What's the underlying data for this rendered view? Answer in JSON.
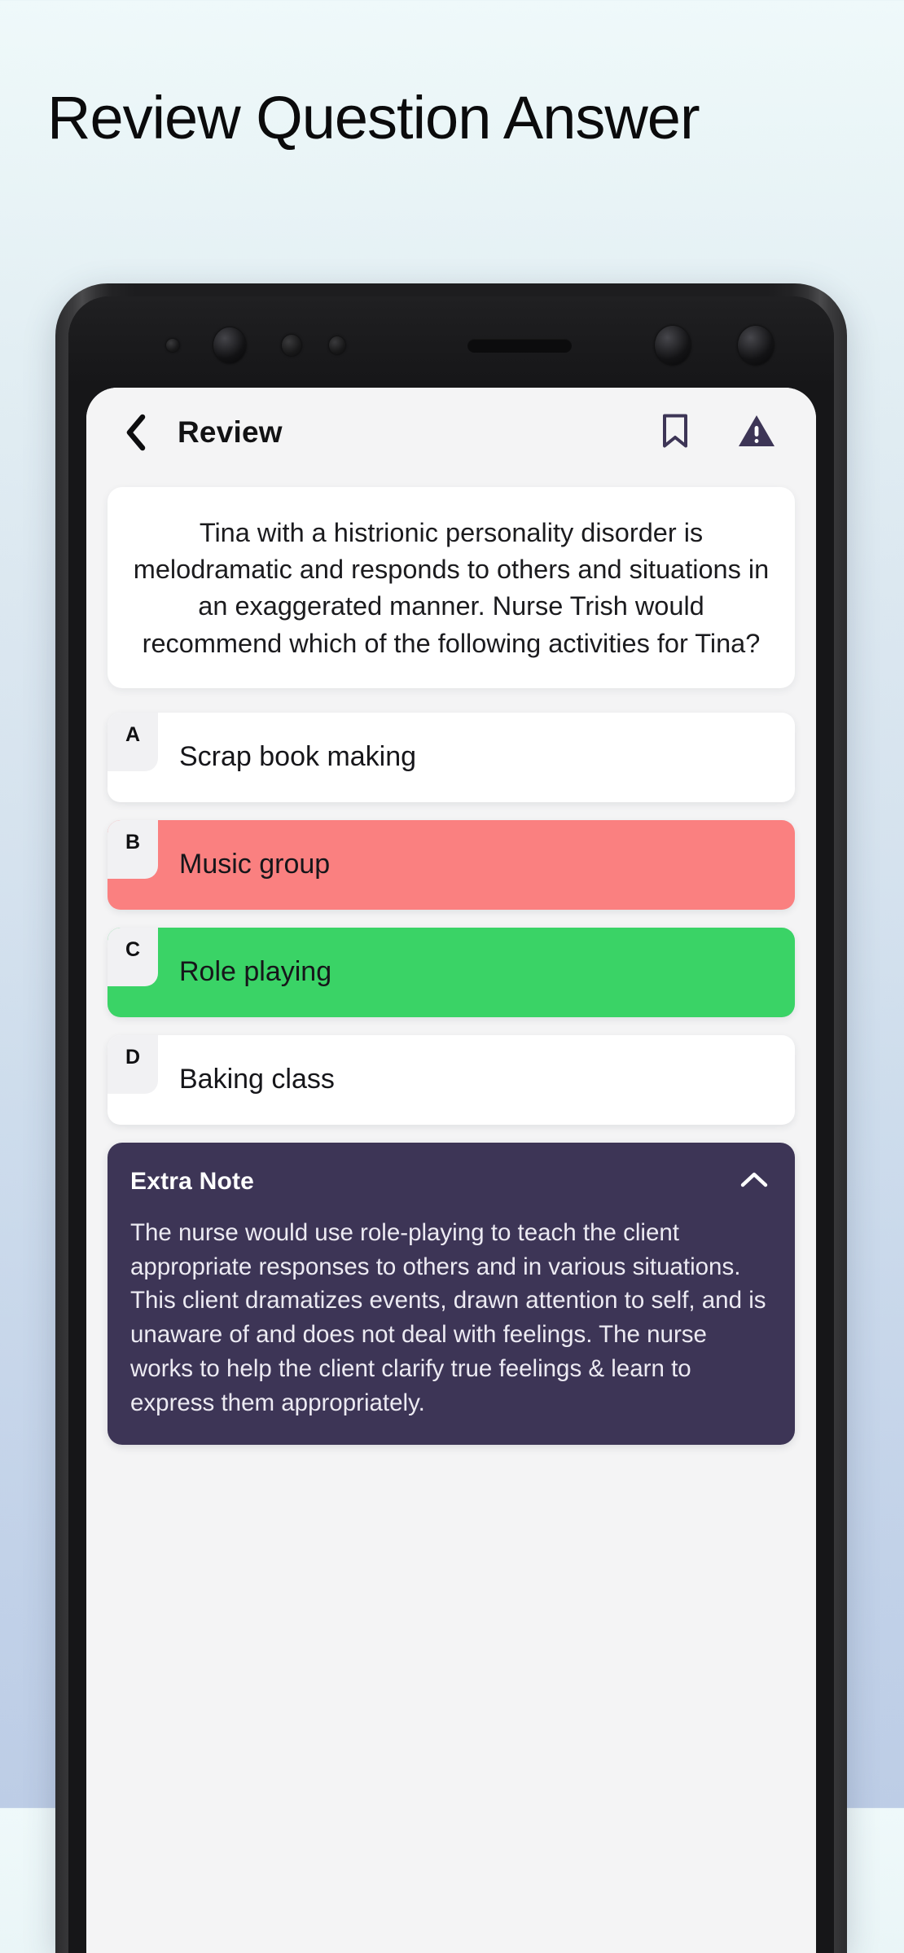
{
  "page": {
    "title": "Review Question Answer"
  },
  "appbar": {
    "title": "Review",
    "back_icon": "chevron-left-icon",
    "bookmark_icon": "bookmark-icon",
    "report_icon": "warning-triangle-icon"
  },
  "question": {
    "text": "Tina with a histrionic personality disorder is melodramatic and responds to others and situations in an exaggerated manner. Nurse Trish would recommend which of the following activities for Tina?"
  },
  "options": [
    {
      "letter": "A",
      "text": "Scrap book making",
      "state": "neutral"
    },
    {
      "letter": "B",
      "text": "Music group",
      "state": "wrong"
    },
    {
      "letter": "C",
      "text": "Role playing",
      "state": "right"
    },
    {
      "letter": "D",
      "text": "Baking class",
      "state": "neutral"
    }
  ],
  "note": {
    "title": "Extra Note",
    "toggle_icon": "chevron-up-icon",
    "body": "The nurse would use role-playing to teach the client appropriate responses to others and in various situations. This client dramatizes events, drawn attention to self, and is unaware of and does not deal with feelings. The nurse works to help the client clarify true feelings & learn to express them appropriately."
  },
  "colors": {
    "wrong": "#fa8080",
    "correct": "#3ad366",
    "note_bg": "#3d3556",
    "accent": "#3d3556",
    "screen_bg": "#f4f4f5",
    "card_bg": "#ffffff",
    "bg_top": "#eff9fa",
    "bg_bottom": "#bdcde6"
  }
}
